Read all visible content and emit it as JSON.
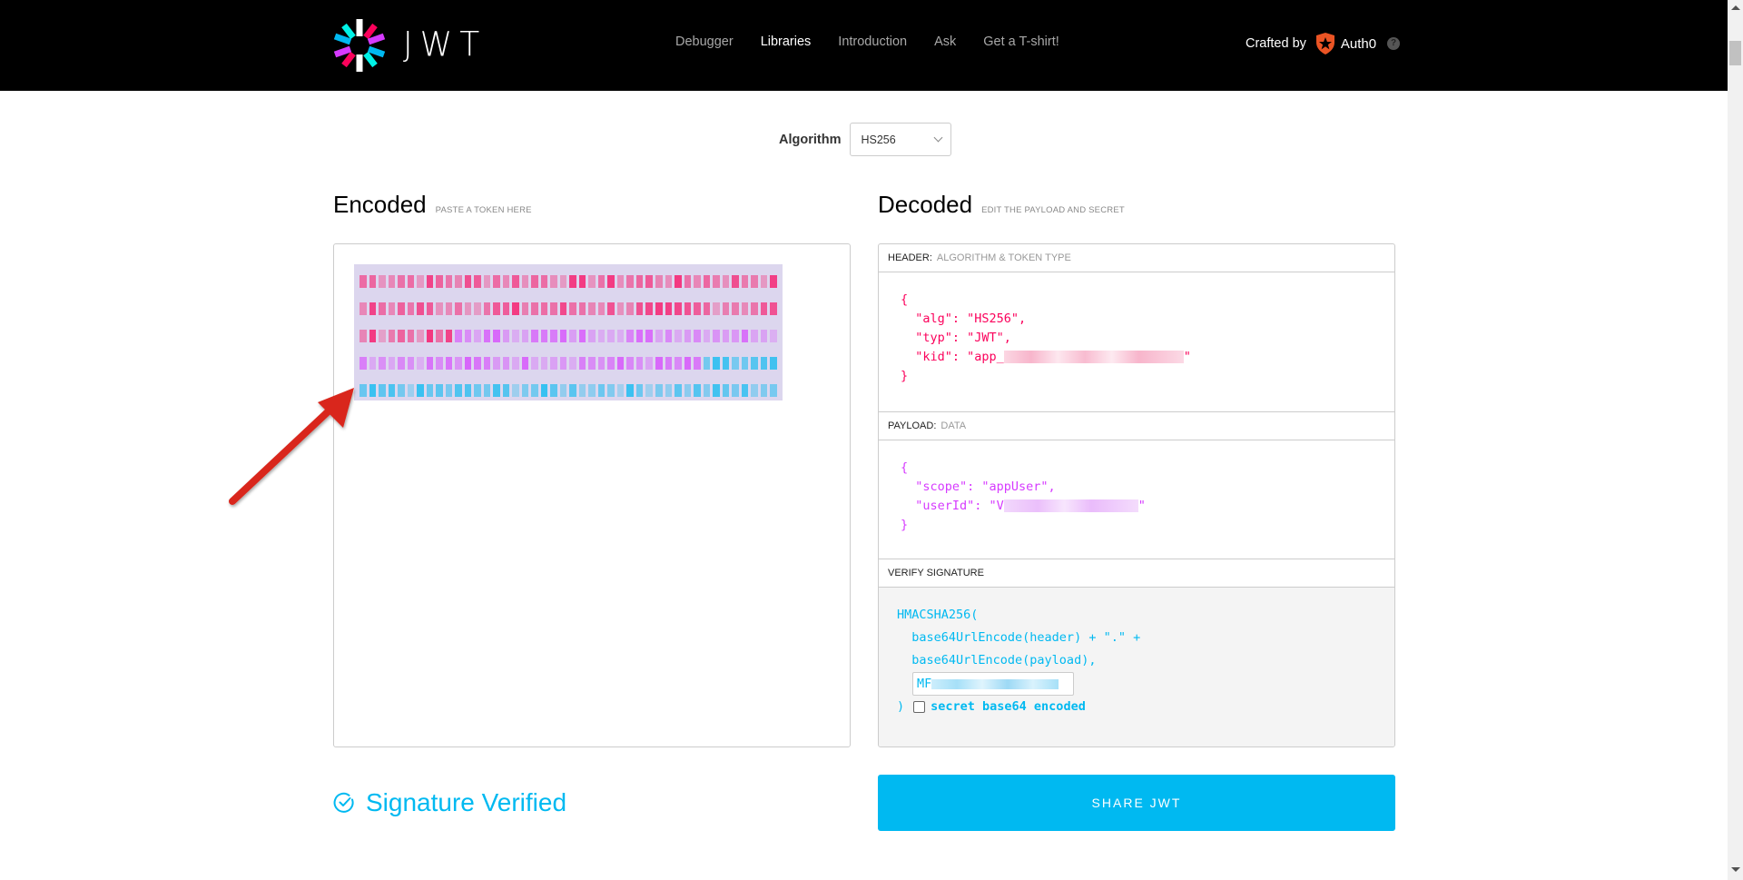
{
  "header": {
    "logo_text": "JWT",
    "nav": [
      {
        "label": "Debugger",
        "active": false
      },
      {
        "label": "Libraries",
        "active": true
      },
      {
        "label": "Introduction",
        "active": false
      },
      {
        "label": "Ask",
        "active": false
      },
      {
        "label": "Get a T-shirt!",
        "active": false
      }
    ],
    "crafted_by_label": "Crafted by",
    "brand_name": "Auth0",
    "help_icon": "?"
  },
  "algorithm": {
    "label": "Algorithm",
    "selected": "HS256"
  },
  "encoded": {
    "title": "Encoded",
    "subtitle": "PASTE A TOKEN HERE",
    "token_redacted": true
  },
  "decoded": {
    "title": "Decoded",
    "subtitle": "EDIT THE PAYLOAD AND SECRET",
    "header_section": {
      "label": "HEADER:",
      "sublabel": "ALGORITHM & TOKEN TYPE",
      "lines": [
        "{",
        "  \"alg\": \"HS256\",",
        "  \"typ\": \"JWT\",",
        "  \"kid\": \"app_",
        "}"
      ],
      "kid_suffix": "\""
    },
    "payload_section": {
      "label": "PAYLOAD:",
      "sublabel": "DATA",
      "lines": [
        "{",
        "  \"scope\": \"appUser\",",
        "  \"userId\": \"V",
        "}"
      ],
      "userid_suffix": "\""
    },
    "verify_section": {
      "label": "VERIFY SIGNATURE",
      "lines": [
        "HMACSHA256(",
        "  base64UrlEncode(header) + \".\" +",
        "  base64UrlEncode(payload),"
      ],
      "secret_prefix": "MF",
      "close_paren": ")",
      "checkbox_label": "secret base64 encoded",
      "checkbox_checked": false
    }
  },
  "status": {
    "signature_text": "Signature Verified"
  },
  "share_button": {
    "label": "SHARE JWT"
  },
  "colors": {
    "header_red": "#fb015b",
    "payload_purple": "#d63aff",
    "signature_blue": "#00b9f1",
    "annotation_arrow": "#d9261c"
  }
}
